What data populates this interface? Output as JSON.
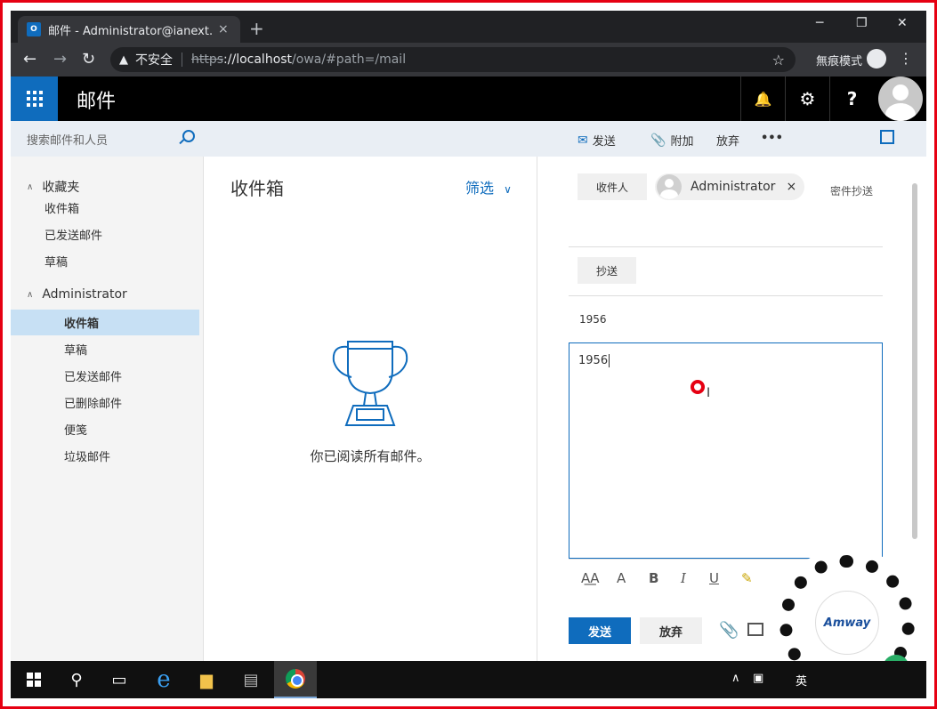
{
  "browser": {
    "tab_title": "邮件 - Administrator@ianext.co",
    "tab_favicon": "O",
    "close_tab": "×",
    "new_tab": "+",
    "minimize": "─",
    "maximize": "❐",
    "close_window": "✕",
    "back": "←",
    "forward": "→",
    "reload": "↻",
    "warning_icon": "▲",
    "insecure_label": "不安全",
    "url_scheme": "https",
    "url_host": "://localhost",
    "url_path": "/owa/#path=/mail",
    "bookmark_star": "☆",
    "incognito_label": "無痕模式",
    "menu": "⋮"
  },
  "owa": {
    "app_title": "邮件",
    "notifications_icon": "🔔",
    "settings_icon": "⚙",
    "help_icon": "?",
    "search_placeholder": "搜索邮件和人员"
  },
  "commands": {
    "send": "发送",
    "attach": "附加",
    "discard": "放弃",
    "more": "•••"
  },
  "folders": {
    "favorites_label": "收藏夹",
    "favorites": [
      "收件箱",
      "已发送邮件",
      "草稿"
    ],
    "account_label": "Administrator",
    "account_items": [
      "收件箱",
      "草稿",
      "已发送邮件",
      "已删除邮件",
      "便笺",
      "垃圾邮件"
    ],
    "selected": "收件箱"
  },
  "message_list": {
    "title": "收件箱",
    "filter_label": "筛选",
    "empty_message": "你已阅读所有邮件。"
  },
  "compose": {
    "to_label": "收件人",
    "recipient_name": "Administrator",
    "remove_recipient": "×",
    "bcc_label": "密件抄送",
    "cc_label": "抄送",
    "subject": "1956",
    "body": "1956",
    "send_label": "发送",
    "discard_label": "放弃",
    "format_tools": [
      "A͟A",
      "A",
      "B",
      "I",
      "U",
      "✎"
    ]
  },
  "overlay": {
    "qr_brand": "Amway"
  },
  "taskbar": {
    "search_icon": "⚲",
    "task_view_icon": "▭",
    "ie_icon": "e",
    "explorer_icon": "▆",
    "tray_chevron": "∧",
    "tray_lang": "英"
  },
  "colors": {
    "accent": "#0f6cbd",
    "frame_red": "#e60012"
  }
}
